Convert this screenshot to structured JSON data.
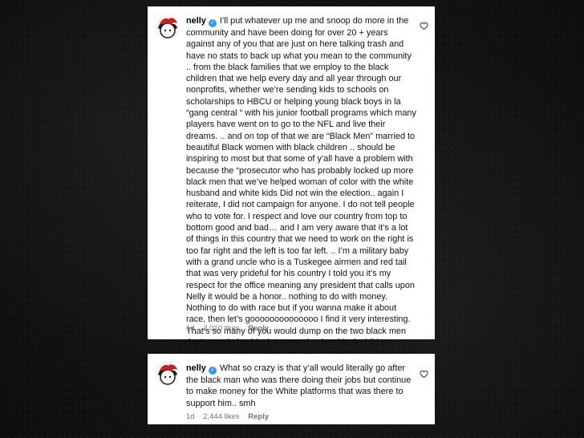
{
  "comments": [
    {
      "username": "nelly",
      "text": "I’ll put whatever up me and snoop do more in the community and have been doing for over 20 + years against any of you that are just on here talking trash and have no stats to back up what you mean to the community .. from the black families that we employ to the black children that we help every day and all year through our nonprofits, whether we’re sending kids to schools on scholarships to HBCU or helping young black boys in la “gang central “ with his junior football programs which many players have went on to go to the NFL and live their dreams. .. and on top of that we are “Black Men” married to beautiful Black women with black children .. should be inspiring to most but that some of y’all have a problem with because the “prosecutor who has probably locked up more black men that we’ve helped woman of color with the white husband and white kids Did not win the election.. again I reiterate, I did not campaign for anyone. I do not tell people who to vote for. I respect and love our country from top to bottom good and bad… and I am very aware that it’s a lot of things in this country that we need to work on the right is too far right and the left is too far left. .. I’m a military baby with a grand uncle who is a Tuskegee airmen and red tail that was very prideful for his country I told you it’s my respect for the office meaning any president that calls upon Nelly it would be a honor.. nothing to do with money. Nothing to do with race but if you wanna make it about race, then let’s goooooooooooooo I find it very interesting. That’s so many of you would dump on the two black men that’s married to black women that has black children because the “” woman of color with the white husband and white kids. Didn’t win..!!",
      "time": "1d",
      "likes": "2,010 likes",
      "reply": "Reply"
    },
    {
      "username": "nelly",
      "text": "What so crazy is that y’all would literally go after the black man who was there doing their jobs but continue to make money for the White platforms that was there to support him.. smh",
      "time": "1d",
      "likes": "2,444 likes",
      "reply": "Reply"
    }
  ],
  "icons": {
    "verified": "verified-badge-icon",
    "like": "heart-outline-icon",
    "avatar": "profile-avatar"
  },
  "colors": {
    "verified": "#3797f0",
    "meta_text": "#737373",
    "background": "#111111"
  }
}
